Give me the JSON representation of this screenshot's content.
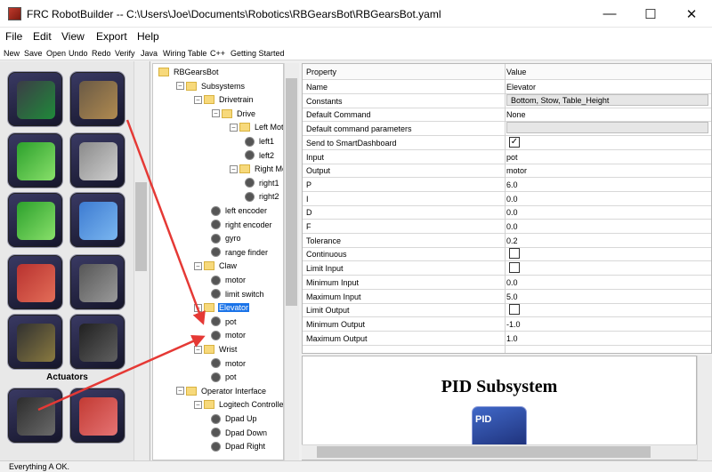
{
  "window": {
    "title": "FRC RobotBuilder -- C:\\Users\\Joe\\Documents\\Robotics\\RBGearsBot\\RBGearsBot.yaml",
    "minimize_glyph": "—",
    "maximize_glyph": "☐",
    "close_glyph": "✕"
  },
  "menu": [
    "File",
    "Edit",
    "View",
    "Export",
    "Help"
  ],
  "toolbar": [
    "New",
    "Save",
    "Open",
    "Undo",
    "Redo",
    "Verify",
    "Java",
    "Wiring Table",
    "C++",
    "Getting Started"
  ],
  "palette": {
    "header": "Actuators",
    "tiles": [
      {
        "name": "gear-sensor-tile",
        "colors": [
          "#3c3c46",
          "#1f8a3a"
        ]
      },
      {
        "name": "potentiometer-tile",
        "colors": [
          "#6a5a45",
          "#b08a50"
        ]
      },
      {
        "name": "analog-sine-tile",
        "colors": [
          "#2ca02c",
          "#88e06a"
        ]
      },
      {
        "name": "limit-switch-tile",
        "colors": [
          "#8a8a8a",
          "#cfcfcf"
        ]
      },
      {
        "name": "digital-pulse-tile",
        "colors": [
          "#2ca02c",
          "#88e06a"
        ]
      },
      {
        "name": "ultrasonic-tile",
        "colors": [
          "#3d7bd1",
          "#7ab6f0"
        ]
      },
      {
        "name": "controller-board-tile",
        "colors": [
          "#b8322f",
          "#e36d58"
        ]
      },
      {
        "name": "motor-encoder-tile",
        "colors": [
          "#565656",
          "#9a9a9a"
        ]
      },
      {
        "name": "breakout-board-tile",
        "colors": [
          "#303030",
          "#8a7a40"
        ]
      },
      {
        "name": "control-board-tile",
        "colors": [
          "#202020",
          "#606060"
        ]
      },
      {
        "name": "motor-controller-tile",
        "colors": [
          "#2c2c2c",
          "#6a6a6a"
        ]
      },
      {
        "name": "red-relay-tile",
        "colors": [
          "#c23a33",
          "#e57373"
        ]
      }
    ]
  },
  "tree": [
    {
      "depth": 0,
      "label": "RBGearsBot",
      "type": "folder"
    },
    {
      "depth": 1,
      "label": "Subsystems",
      "type": "folder",
      "toggle": "–"
    },
    {
      "depth": 2,
      "label": "Drivetrain",
      "type": "folder",
      "toggle": "–"
    },
    {
      "depth": 3,
      "label": "Drive",
      "type": "folder",
      "toggle": "–"
    },
    {
      "depth": 4,
      "label": "Left Motor",
      "type": "folder",
      "toggle": "–"
    },
    {
      "depth": 5,
      "label": "left1",
      "type": "leaf"
    },
    {
      "depth": 5,
      "label": "left2",
      "type": "leaf"
    },
    {
      "depth": 4,
      "label": "Right Motor",
      "type": "folder",
      "toggle": "–"
    },
    {
      "depth": 5,
      "label": "right1",
      "type": "leaf"
    },
    {
      "depth": 5,
      "label": "right2",
      "type": "leaf"
    },
    {
      "depth": 3,
      "label": "left encoder",
      "type": "leaf"
    },
    {
      "depth": 3,
      "label": "right encoder",
      "type": "leaf"
    },
    {
      "depth": 3,
      "label": "gyro",
      "type": "leaf"
    },
    {
      "depth": 3,
      "label": "range finder",
      "type": "leaf"
    },
    {
      "depth": 2,
      "label": "Claw",
      "type": "folder",
      "toggle": "–"
    },
    {
      "depth": 3,
      "label": "motor",
      "type": "leaf"
    },
    {
      "depth": 3,
      "label": "limit switch",
      "type": "leaf"
    },
    {
      "depth": 2,
      "label": "Elevator",
      "type": "folder",
      "toggle": "–",
      "selected": true
    },
    {
      "depth": 3,
      "label": "pot",
      "type": "leaf"
    },
    {
      "depth": 3,
      "label": "motor",
      "type": "leaf"
    },
    {
      "depth": 2,
      "label": "Wrist",
      "type": "folder",
      "toggle": "–"
    },
    {
      "depth": 3,
      "label": "motor",
      "type": "leaf"
    },
    {
      "depth": 3,
      "label": "pot",
      "type": "leaf"
    },
    {
      "depth": 1,
      "label": "Operator Interface",
      "type": "folder",
      "toggle": "–"
    },
    {
      "depth": 2,
      "label": "Logitech Controller",
      "type": "folder",
      "toggle": "–"
    },
    {
      "depth": 3,
      "label": "Dpad Up",
      "type": "leaf"
    },
    {
      "depth": 3,
      "label": "Dpad Down",
      "type": "leaf"
    },
    {
      "depth": 3,
      "label": "Dpad Right",
      "type": "leaf"
    }
  ],
  "properties": {
    "headers": [
      "Property",
      "Value"
    ],
    "rows": [
      {
        "name": "Name",
        "value": "Elevator"
      },
      {
        "name": "Constants",
        "value": "Bottom, Stow, Table_Height",
        "kind": "button"
      },
      {
        "name": "Default Command",
        "value": "None"
      },
      {
        "name": "Default command parameters",
        "value": "",
        "kind": "button"
      },
      {
        "name": "Send to SmartDashboard",
        "value": "✓",
        "kind": "check"
      },
      {
        "name": "Input",
        "value": "pot"
      },
      {
        "name": "Output",
        "value": "motor"
      },
      {
        "name": "P",
        "value": "6.0"
      },
      {
        "name": "I",
        "value": "0.0"
      },
      {
        "name": "D",
        "value": "0.0"
      },
      {
        "name": "F",
        "value": "0.0"
      },
      {
        "name": "Tolerance",
        "value": "0.2"
      },
      {
        "name": "Continuous",
        "value": "",
        "kind": "check"
      },
      {
        "name": "Limit Input",
        "value": "",
        "kind": "check"
      },
      {
        "name": "Minimum Input",
        "value": "0.0"
      },
      {
        "name": "Maximum Input",
        "value": "5.0"
      },
      {
        "name": "Limit Output",
        "value": "",
        "kind": "check"
      },
      {
        "name": "Minimum Output",
        "value": "-1.0"
      },
      {
        "name": "Maximum Output",
        "value": "1.0"
      }
    ]
  },
  "doc": {
    "title": "PID Subsystem",
    "image_label": "PID"
  },
  "status": {
    "text": "Everything A OK."
  },
  "colors": {
    "selection": "#1a73e8",
    "arrow": "#e53935",
    "tile_bg": "#23233a"
  }
}
